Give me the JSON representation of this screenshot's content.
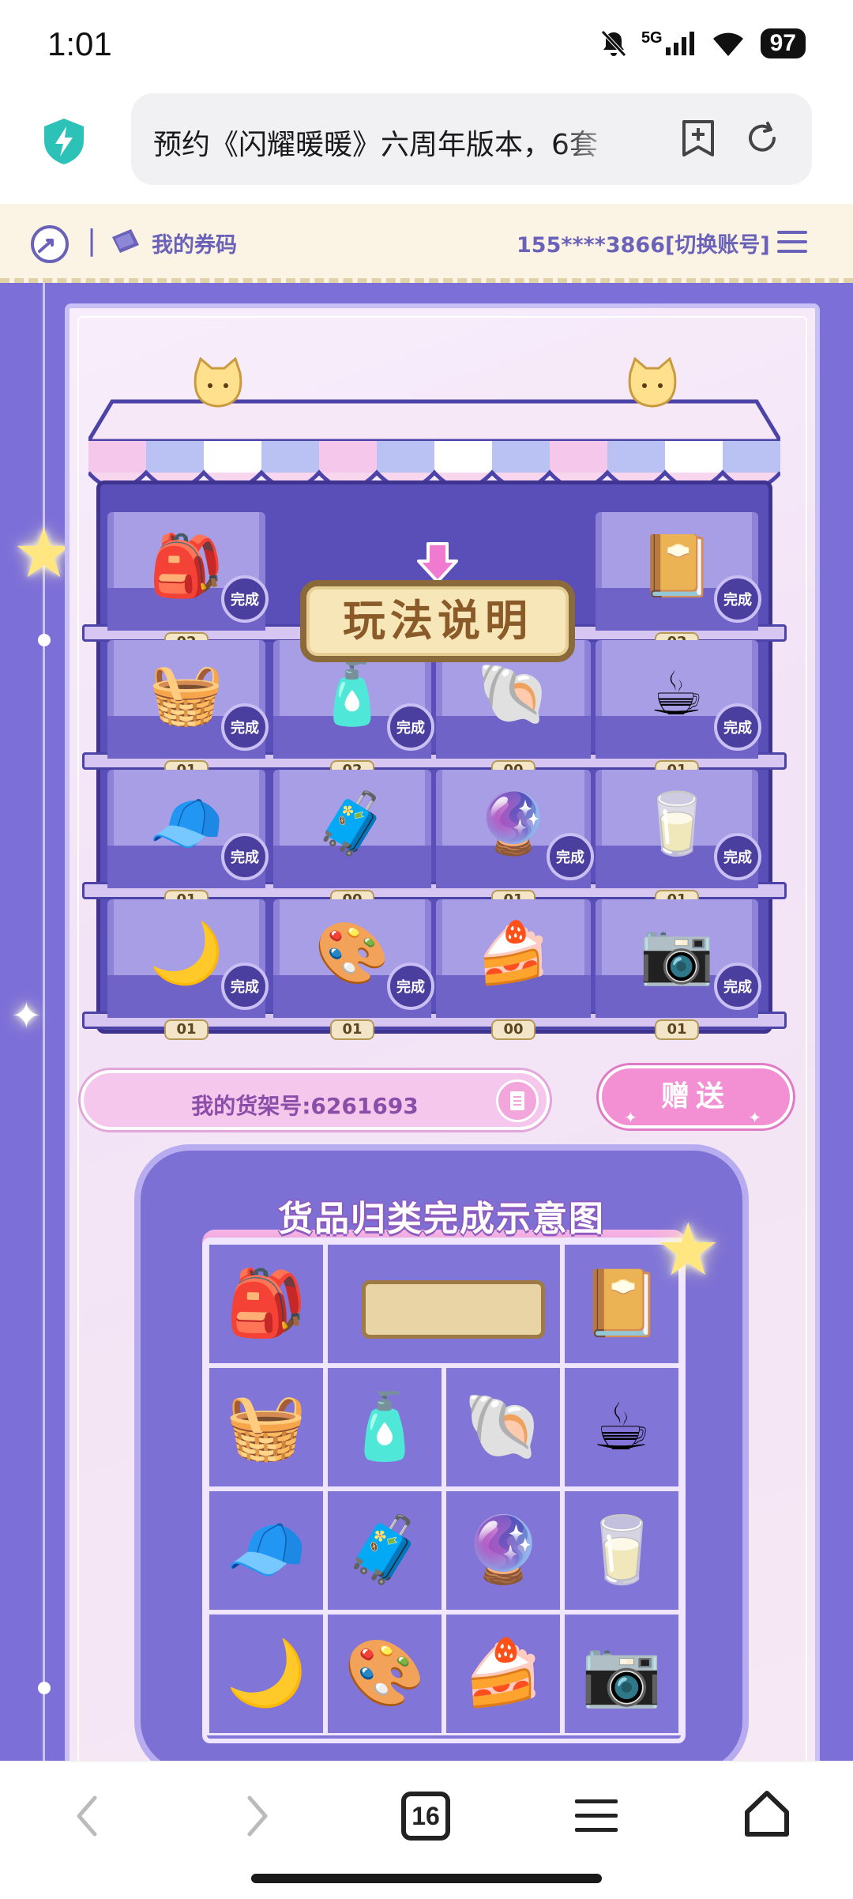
{
  "status_bar": {
    "time": "1:01",
    "network": "5G",
    "battery": "97",
    "icons": [
      "bell-off-icon",
      "signal-icon",
      "wifi-icon",
      "battery-icon"
    ]
  },
  "browser": {
    "url_title": "预约《闪耀暖暖》六周年版本，6套",
    "tab_count": "16",
    "icons": [
      "shield-icon",
      "bookmark-add-icon",
      "reload-icon"
    ]
  },
  "site_nav": {
    "separator": "|",
    "coupon_label": "我的券码",
    "account": "155****3866[切换账号]"
  },
  "shelf": {
    "rules_button": "玩法说明",
    "done_label": "完成",
    "rows": [
      [
        {
          "icon": "🎒",
          "count": "02",
          "done": true
        },
        {
          "icon": "",
          "count": "",
          "done": false
        },
        {
          "icon": "",
          "count": "",
          "done": false
        },
        {
          "icon": "📔",
          "count": "02",
          "done": true
        }
      ],
      [
        {
          "icon": "🧺",
          "count": "01",
          "done": true
        },
        {
          "icon": "🧴",
          "count": "02",
          "done": true
        },
        {
          "icon": "🐚",
          "count": "00",
          "done": false
        },
        {
          "icon": "☕",
          "count": "01",
          "done": true
        }
      ],
      [
        {
          "icon": "🧢",
          "count": "01",
          "done": true
        },
        {
          "icon": "🧳",
          "count": "00",
          "done": false
        },
        {
          "icon": "🔮",
          "count": "01",
          "done": true
        },
        {
          "icon": "🥛",
          "count": "01",
          "done": true
        }
      ],
      [
        {
          "icon": "🌙",
          "count": "01",
          "done": true
        },
        {
          "icon": "🎨",
          "count": "01",
          "done": true
        },
        {
          "icon": "🍰",
          "count": "00",
          "done": false
        },
        {
          "icon": "📷",
          "count": "01",
          "done": true
        }
      ]
    ]
  },
  "shelf_number": "我的货架号:6261693",
  "gift_button": "赠送",
  "demo": {
    "title": "货品归类完成示意图",
    "rows": [
      [
        "🎒",
        "",
        "",
        "📔"
      ],
      [
        "🧺",
        "🧴",
        "🐚",
        "☕"
      ],
      [
        "🧢",
        "🧳",
        "🔮",
        "🥛"
      ],
      [
        "🌙",
        "🎨",
        "🍰",
        "📷"
      ]
    ]
  },
  "bottom_nav": {
    "icons": [
      "back-icon",
      "forward-icon",
      "tabs-icon",
      "menu-icon",
      "home-icon"
    ]
  },
  "colors": {
    "page_purple": "#7c6fd8",
    "shelf_dark": "#5a4fb8",
    "pink_accent": "#f390d4",
    "nav_text": "#6a62b8"
  }
}
